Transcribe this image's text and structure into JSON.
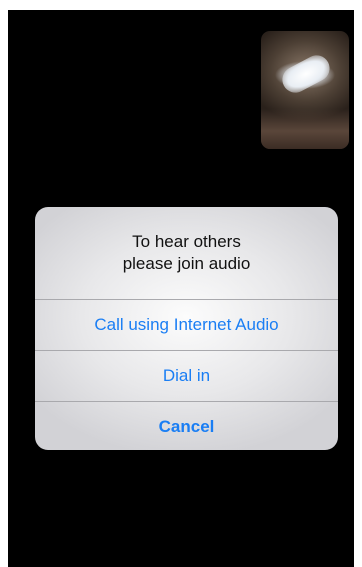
{
  "dialog": {
    "title_line1": "To hear others",
    "title_line2": "please join audio",
    "buttons": {
      "internet_audio": "Call using Internet Audio",
      "dial_in": "Dial in",
      "cancel": "Cancel"
    }
  },
  "colors": {
    "accent": "#1a7ef4",
    "background": "#000000",
    "dialog": "#e8e8ea"
  },
  "icons": {
    "self_view": "camera-preview-thumbnail"
  }
}
